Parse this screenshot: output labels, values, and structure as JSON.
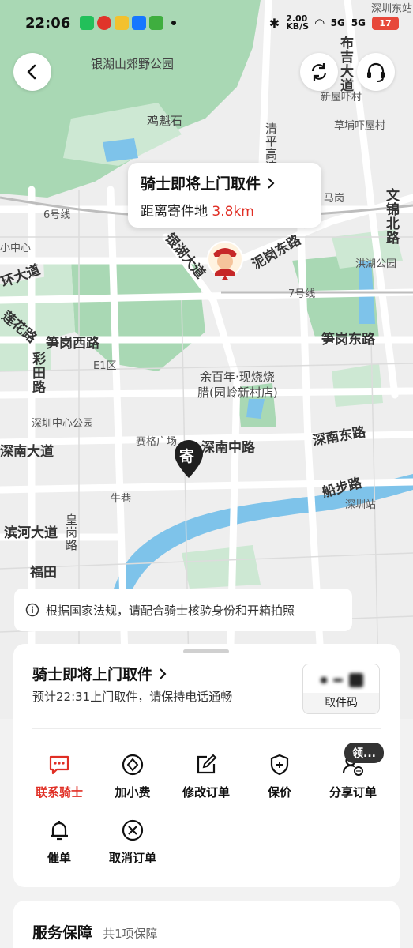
{
  "status_bar": {
    "time": "22:06",
    "net_speed": "2.00",
    "net_unit": "KB/S",
    "signal1": "5G",
    "signal2": "5G",
    "battery": "17"
  },
  "map": {
    "labels": {
      "yinhu_park": "银湖山郊野公园",
      "jikuishi": "鸡魁石",
      "xinwucun": "新屋吓村",
      "caopu": "草埔吓屋村",
      "shenzhen_east": "深圳东站",
      "buji_road": "布吉大道",
      "qingping": "清平高速",
      "line6": "6号线",
      "line7": "7号线",
      "yinhu_road": "银湖大道",
      "magang": "马岗",
      "wenjin_north": "文锦北路",
      "hongling": "洪湖公园",
      "nigang_east": "泥岗东路",
      "xiaozhongxin": "小中心",
      "huan": "环大道",
      "lianhua": "莲花路",
      "caitian": "彩田路",
      "sungang_west": "笋岗西路",
      "sungang_east": "笋岗东路",
      "e1": "E1区",
      "yubainian": "余百年·现烧烧",
      "yubainian2": "腊(园岭新村店)",
      "sz_center_park": "深圳中心公园",
      "saige": "赛格广场",
      "shennan_mid": "深南中路",
      "shennan_east": "深南东路",
      "shennan_road": "深南大道",
      "niuxiang": "牛巷",
      "chuanbu": "船步路",
      "shenzhen_station": "深圳站",
      "binhe": "滨河大道",
      "huanggang": "皇岗路",
      "futian": "福田"
    }
  },
  "bubble": {
    "title": "骑士即将上门取件",
    "distance_label": "距离寄件地",
    "distance_value": "3.8km"
  },
  "pin_label": "寄",
  "notice": "根据国家法规，请配合骑士核验身份和开箱拍照",
  "order_card": {
    "title": "骑士即将上门取件",
    "subtitle": "预计22:31上门取件，请保持电话通畅",
    "pickup_code_label": "取件码"
  },
  "actions": [
    {
      "label": "联系骑士",
      "icon": "chat-icon"
    },
    {
      "label": "加小费",
      "icon": "tip-icon"
    },
    {
      "label": "修改订单",
      "icon": "edit-icon"
    },
    {
      "label": "保价",
      "icon": "insure-icon"
    },
    {
      "label": "分享订单",
      "icon": "share-icon"
    },
    {
      "label": "催单",
      "icon": "bell-icon"
    },
    {
      "label": "取消订单",
      "icon": "cancel-icon"
    }
  ],
  "share_badge": "领...",
  "service": {
    "title": "服务保障",
    "count": "共1项保障"
  },
  "colors": {
    "accent_red": "#e02e24",
    "map_green": "#a9d8b4",
    "water_blue": "#7ec3ea"
  }
}
